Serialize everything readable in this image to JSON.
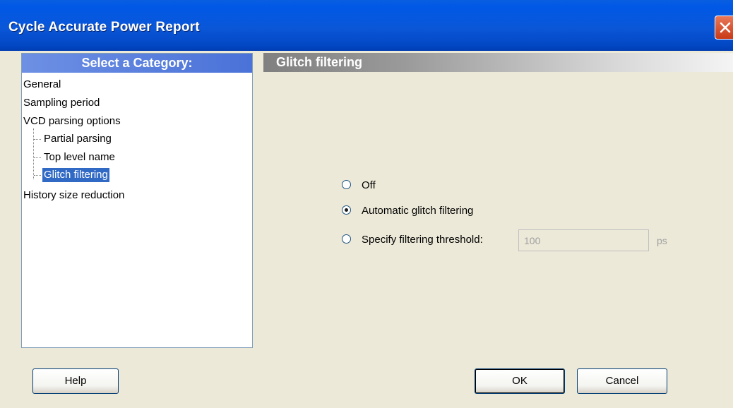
{
  "window": {
    "title": "Cycle Accurate Power Report"
  },
  "icons": {
    "close": "close-icon"
  },
  "category_panel": {
    "header": "Select a Category:",
    "items": [
      {
        "label": "General",
        "level": 0,
        "selected": false
      },
      {
        "label": "Sampling period",
        "level": 0,
        "selected": false
      },
      {
        "label": "VCD parsing options",
        "level": 0,
        "selected": false
      },
      {
        "label": "Partial parsing",
        "level": 1,
        "selected": false
      },
      {
        "label": "Top level name",
        "level": 1,
        "selected": false
      },
      {
        "label": "Glitch filtering",
        "level": 1,
        "selected": true
      },
      {
        "label": "History size reduction",
        "level": 0,
        "selected": false
      }
    ]
  },
  "section": {
    "title": "Glitch filtering",
    "options": [
      {
        "label": "Off",
        "checked": false
      },
      {
        "label": "Automatic glitch filtering",
        "checked": true
      },
      {
        "label": "Specify filtering threshold:",
        "checked": false
      }
    ],
    "threshold_value": "100",
    "threshold_unit": "ps"
  },
  "buttons": {
    "help": "Help",
    "ok": "OK",
    "cancel": "Cancel"
  },
  "colors": {
    "titlebar": "#0A57D8",
    "selection": "#316AC5",
    "dialog_bg": "#ECE9D8"
  }
}
